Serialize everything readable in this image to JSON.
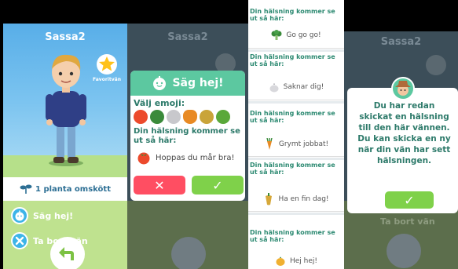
{
  "panel1": {
    "friend_name": "Sassa2",
    "favorite_label": "Favoritvän",
    "plants_text": "1 planta omskött",
    "menu": [
      {
        "label": "Säg hej!"
      },
      {
        "label": "Ta bort vän"
      }
    ]
  },
  "panel2": {
    "bg_name": "Sassa2",
    "dialog_title": "Säg hej!",
    "choose_emoji_label": "Välj emoji:",
    "preview_label": "Din hälsning kommer se ut så här:",
    "preview_text": "Hoppas du mår bra!",
    "cancel_symbol": "✕",
    "confirm_symbol": "✓"
  },
  "panel3": {
    "cards": [
      {
        "header": "Din hälsning kommer se ut så här:",
        "text": "Go go go!"
      },
      {
        "header": "Din hälsning kommer se ut så här:",
        "text": "Saknar dig!"
      },
      {
        "header": "Din hälsning kommer se ut så här:",
        "text": "Grymt jobbat!"
      },
      {
        "header": "Din hälsning kommer se ut så här:",
        "text": "Ha en fin dag!"
      },
      {
        "header": "Din hälsning kommer se ut så här:",
        "text": "Hej hej!"
      }
    ]
  },
  "panel4": {
    "bg_name": "Sassa2",
    "bg_remove": "Ta bort vän",
    "message_lines": [
      "Du har redan",
      "skickat en hälsning",
      "till den här vännen.",
      "Du kan skicka en ny",
      "när din vän har sett",
      "hälsningen."
    ],
    "ok_symbol": "✓"
  },
  "colors": {
    "accent_teal": "#5cc8a0",
    "cancel_red": "#ff4e62",
    "confirm_green": "#7fd14a",
    "sky_blue": "#58aee8"
  }
}
